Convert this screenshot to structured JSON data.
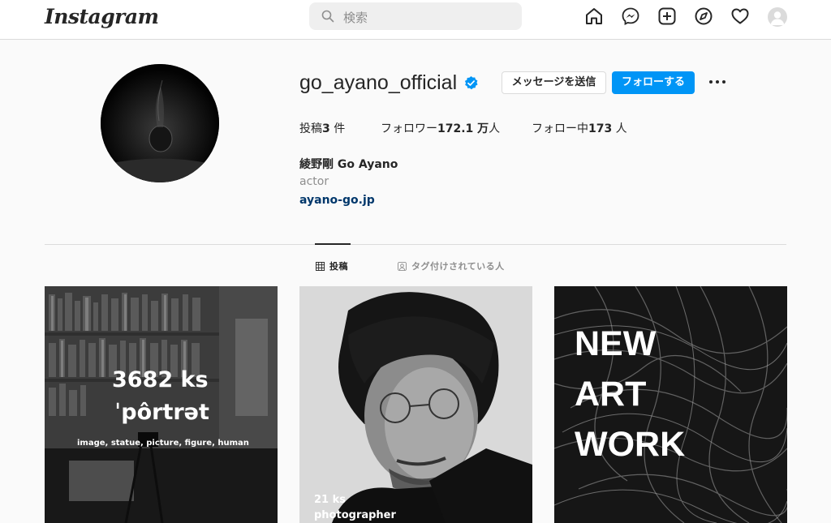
{
  "header": {
    "logo": "Instagram",
    "search_placeholder": "検索",
    "icons": [
      "home-icon",
      "messenger-icon",
      "new-post-icon",
      "explore-icon",
      "activity-heart-icon",
      "profile-avatar-icon"
    ]
  },
  "profile": {
    "username": "go_ayano_official",
    "verified": true,
    "message_button": "メッセージを送信",
    "follow_button": "フォローする",
    "posts_label": "投稿",
    "posts_count": "3",
    "posts_suffix": " 件",
    "followers_label": "フォロワー",
    "followers_count": "172.1 万",
    "followers_suffix": "人",
    "following_label": "フォロー中",
    "following_count": "173",
    "following_suffix": " 人",
    "full_name": "綾野剛 Go Ayano",
    "category": "actor",
    "website": "ayano-go.jp"
  },
  "tabs": {
    "posts": "投稿",
    "tagged": "タグ付けされている人"
  },
  "posts": [
    {
      "count": "3682 ks",
      "word": "ˈpôrtrət",
      "tags": "image, statue, picture, figure, human"
    },
    {
      "count": "21 ks",
      "label": "photographer"
    },
    {
      "lines": "NEW ART WORK"
    }
  ],
  "colors": {
    "accent": "#0095f6",
    "verified": "#0095f6",
    "link": "#00376b"
  }
}
